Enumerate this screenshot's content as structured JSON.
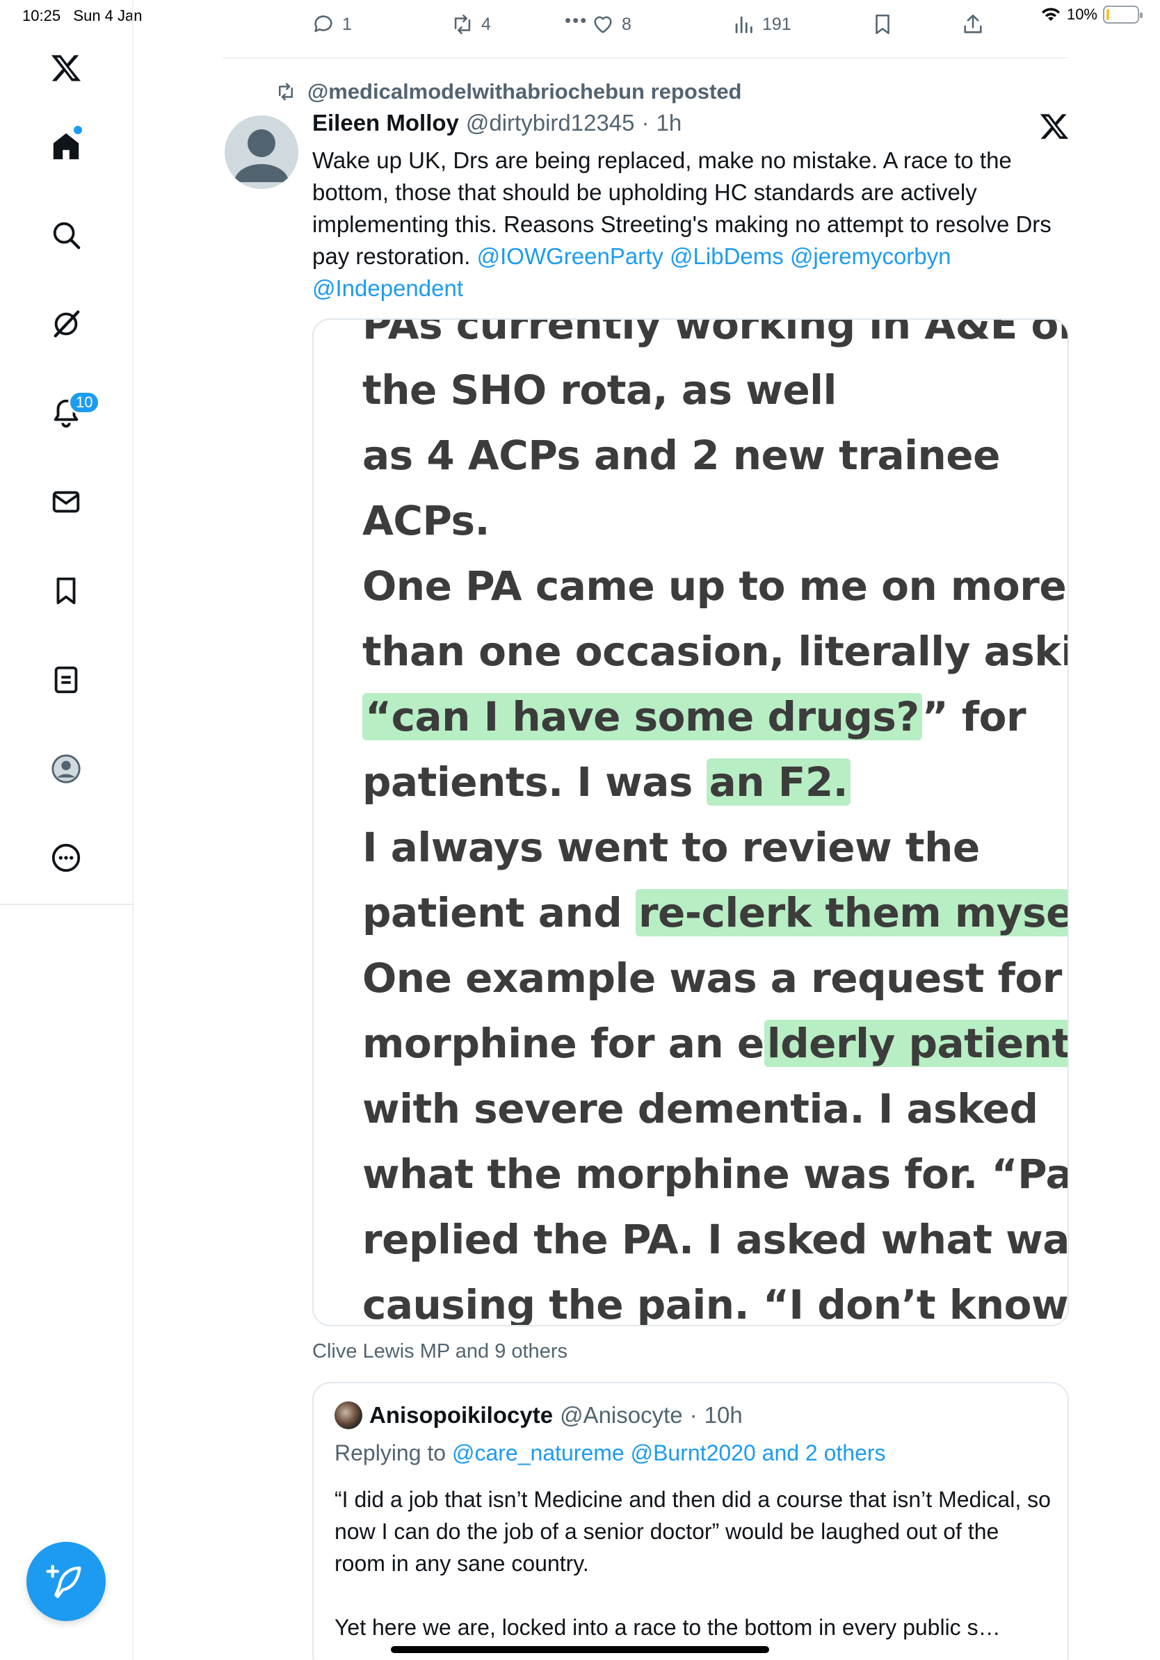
{
  "status_bar": {
    "time": "10:25",
    "date": "Sun 4 Jan",
    "battery": "10%",
    "battery_level": 0.1
  },
  "sidebar": {
    "items": [
      {
        "name": "x-logo-icon"
      },
      {
        "name": "home-icon"
      },
      {
        "name": "search-icon"
      },
      {
        "name": "grok-icon"
      },
      {
        "name": "notifications-icon"
      },
      {
        "name": "messages-icon"
      },
      {
        "name": "bookmarks-icon"
      },
      {
        "name": "lists-icon"
      },
      {
        "name": "profile-icon"
      },
      {
        "name": "more-icon"
      }
    ],
    "notification_count": "10",
    "compose_icon": "feather-plus-icon"
  },
  "action_bar": {
    "replies": "1",
    "reposts": "4",
    "likes": "8",
    "views": "191"
  },
  "tweet": {
    "reposted_by": "@medicalmodelwithabriochebun reposted",
    "author_name": "Eileen Molloy",
    "author_handle": "@dirtybird12345",
    "separator": "·",
    "time": "1h",
    "text": "Wake up UK,  Drs are being replaced, make no mistake. A race to the bottom, those that should be upholding HC standards are actively implementing this. Reasons  Streeting's making no attempt to resolve Drs pay restoration.",
    "mentions": [
      "@IOWGreenParty",
      "@LibDems",
      "@jeremycorbyn",
      "@Independent"
    ],
    "liked_by": "Clive Lewis MP and 9 others"
  },
  "media": {
    "cut_line": "PAs currently working in A&E on",
    "lines": [
      {
        "pre": "the SHO rota, as well",
        "hl": "",
        "post": ""
      },
      {
        "pre": "as 4 ACPs and 2 new trainee",
        "hl": "",
        "post": ""
      },
      {
        "pre": "ACPs.",
        "hl": "",
        "post": ""
      },
      {
        "pre": "One PA came up to me on more",
        "hl": "",
        "post": ""
      },
      {
        "pre": "than one occasion, literally asking",
        "hl": "",
        "post": ""
      },
      {
        "pre": "",
        "hl": "“can I have some drugs?",
        "post": "” for"
      },
      {
        "pre": "patients. I was ",
        "hl": "an F2.",
        "post": ""
      },
      {
        "pre": "I always went to review the",
        "hl": "",
        "post": ""
      },
      {
        "pre": "patient and ",
        "hl": "re-clerk them myself.",
        "post": ""
      },
      {
        "pre": "One example was a request for",
        "hl": "",
        "post": ""
      },
      {
        "pre": "morphine for an e",
        "hl": "lderly patient",
        "post": ""
      },
      {
        "pre": "with severe dementia. I asked",
        "hl": "",
        "post": ""
      },
      {
        "pre": "what the morphine was for. “Pain”",
        "hl": "",
        "post": ""
      },
      {
        "pre": "replied the PA. I asked what was",
        "hl": "",
        "post": ""
      },
      {
        "pre": "causing the pain. “I don’t know",
        "hl": "",
        "post": ""
      }
    ]
  },
  "quote": {
    "author_name": "Anisopoikilocyte",
    "author_handle": "@Anisocyte",
    "separator": "·",
    "time": "10h",
    "replying_prefix": "Replying to ",
    "replying_targets": "@care_natureme @Burnt2020 and 2 others",
    "paragraph1": "“I did a job that isn’t Medicine and then did a course that isn’t Medical, so now I can do the job of a senior doctor” would be laughed out of the room in any sane country.",
    "paragraph2": "Yet here we are, locked into a race to the bottom in every public s…"
  }
}
